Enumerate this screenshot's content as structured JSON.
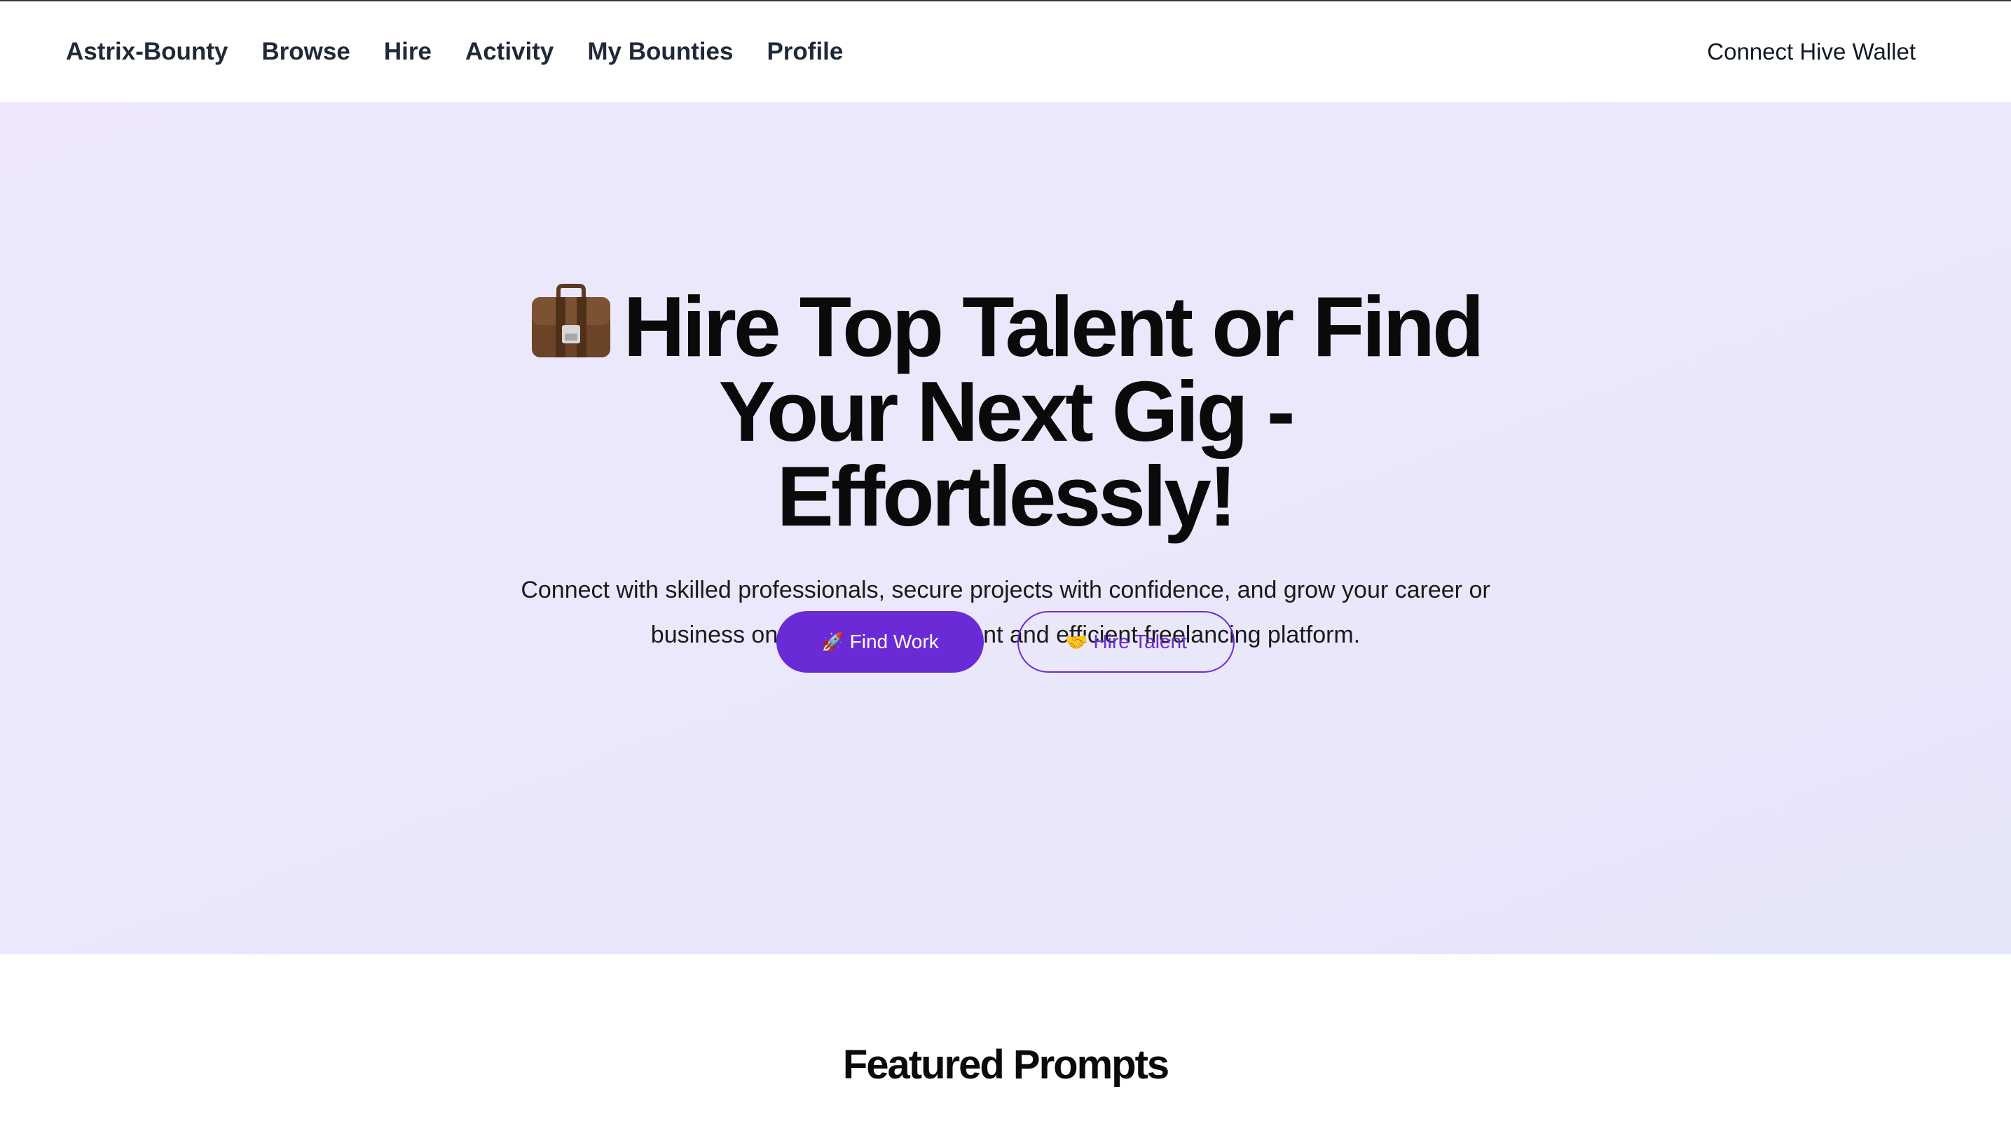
{
  "nav": {
    "brand": "Astrix-Bounty",
    "links": [
      "Browse",
      "Hire",
      "Activity",
      "My Bounties",
      "Profile"
    ],
    "wallet_button": "Connect Hive Wallet"
  },
  "hero": {
    "title_icon": "briefcase-icon",
    "title": "Hire Top Talent or Find Your Next Gig - Effortlessly!",
    "subtitle": "Connect with skilled professionals, secure projects with confidence, and grow your career or business on the most transparent and efficient freelancing platform.",
    "primary_button": {
      "icon": "🚀",
      "label": "Find Work"
    },
    "secondary_button": {
      "icon": "🤝",
      "label": "Hire Talent"
    }
  },
  "featured": {
    "title": "Featured Prompts"
  },
  "colors": {
    "accent": "#6a2bd6",
    "hero_bg_start": "#efe8fc",
    "hero_bg_end": "#e6e6f9",
    "nav_text": "#1f2937"
  }
}
